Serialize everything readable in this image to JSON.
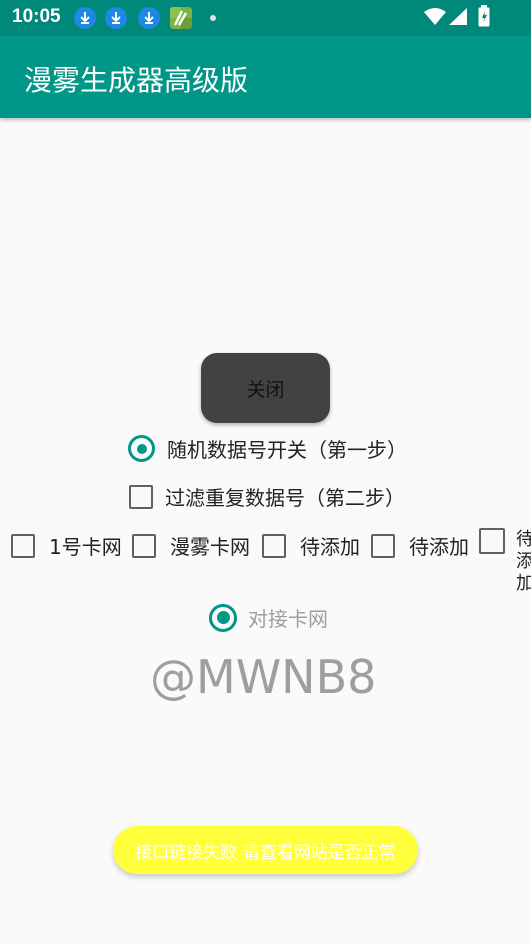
{
  "status_bar": {
    "time": "10:05",
    "icons": [
      "download-icon",
      "download-icon",
      "download-icon",
      "app-notification-icon",
      "dot-icon",
      "wifi-icon",
      "signal-icon",
      "battery-icon"
    ]
  },
  "app_bar": {
    "title": "漫雾生成器高级版"
  },
  "main": {
    "close_button": "关闭",
    "random_toggle": "随机数据号开关（第一步）",
    "filter_repeat": "过滤重复数据号（第二步）",
    "card_options": [
      "1号卡网",
      "漫雾卡网",
      "待添加",
      "待添加"
    ],
    "card_option_vertical": "待添加",
    "dock_card": "对接卡网",
    "handle": "@MWNB8"
  },
  "toast": {
    "message": "接口链接失败 请查看网站是否正常"
  },
  "colors": {
    "accent": "#009688",
    "status_bar": "#00897b",
    "toast_bg": "#ffff3b"
  }
}
